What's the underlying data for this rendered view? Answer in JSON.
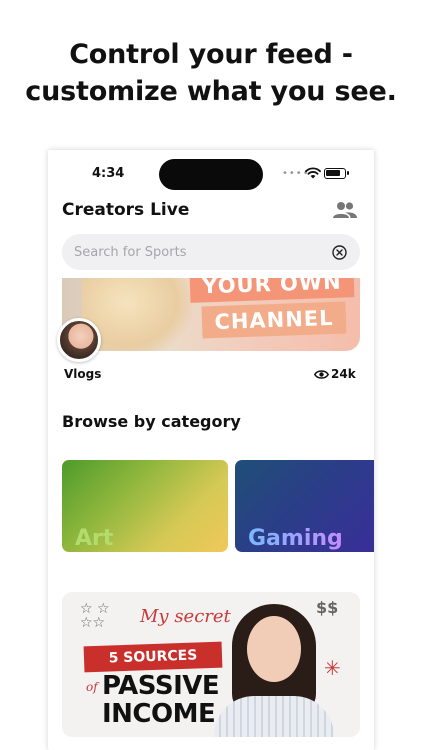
{
  "headline": {
    "line1": "Control your feed -",
    "line2": "customize what you see."
  },
  "status_bar": {
    "time": "4:34"
  },
  "app": {
    "title": "Creators Live",
    "search": {
      "placeholder": "Search for Sports"
    },
    "featured": {
      "banner_line1": "YOUR OWN",
      "banner_line2": "CHANNEL",
      "label": "Vlogs",
      "views": "24k"
    },
    "browse": {
      "title": "Browse by category",
      "categories": [
        "Art",
        "Gaming"
      ]
    },
    "promo": {
      "script_text": "My secret",
      "band_text": "5 SOURCES",
      "of_text": "of",
      "big_text_line1": "PASSIVE",
      "big_text_line2": "INCOME"
    }
  },
  "icons": {
    "people": "people-icon",
    "clear": "clear-icon",
    "eye": "eye-icon",
    "wifi": "wifi-icon",
    "battery": "battery-icon"
  }
}
